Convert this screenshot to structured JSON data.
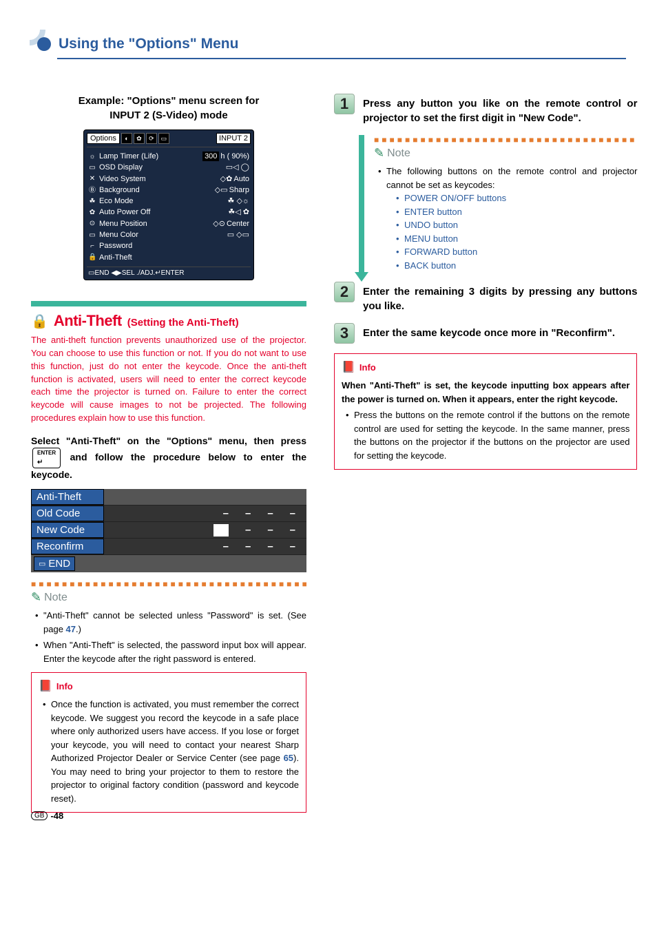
{
  "header": {
    "title": "Using the \"Options\" Menu"
  },
  "example": {
    "line1": "Example: \"Options\" menu screen for",
    "line2": "INPUT 2 (S-Video) mode"
  },
  "options_screen": {
    "active_tab": "Options",
    "input_label": "INPUT 2",
    "rows": {
      "lamp": {
        "label": "Lamp Timer (Life)",
        "value": "300",
        "unit": "h (   90%)"
      },
      "osd": {
        "label": "OSD Display"
      },
      "video": {
        "label": "Video System",
        "value": "Auto"
      },
      "bg": {
        "label": "Background",
        "value": "Sharp"
      },
      "eco": {
        "label": "Eco Mode"
      },
      "autopower": {
        "label": "Auto Power Off"
      },
      "menupos": {
        "label": "Menu Position",
        "value": "Center"
      },
      "menucolor": {
        "label": "Menu Color"
      },
      "password": {
        "label": "Password"
      },
      "antitheft": {
        "label": "Anti-Theft"
      }
    },
    "footer": "END ◀▶SEL ./ADJ.↵ENTER"
  },
  "anti_theft": {
    "title": "Anti-Theft",
    "subtitle": "(Setting the Anti-Theft)",
    "intro": "The anti-theft function prevents unauthorized use of the projector. You can choose to use this function or not. If you do not want to use this function, just do not enter the keycode. Once the anti-theft function is activated, users will need to enter the correct keycode each time the projector is turned on. Failure to enter the correct keycode will cause images to not be projected. The following procedures explain how to use this function.",
    "select_inst_before": "Select \"Anti-Theft\" on the \"Options\" menu, then press ",
    "enter_label": "ENTER",
    "enter_symbol": "↵",
    "select_inst_after": " and follow the procedure below to enter the keycode."
  },
  "at_table": {
    "header": "Anti-Theft",
    "old": "Old Code",
    "new": "New Code",
    "reconfirm": "Reconfirm",
    "end": "END"
  },
  "note1": {
    "label": "Note",
    "item1_a": "\"Anti-Theft\" cannot be selected unless \"Password\" is set. (See page ",
    "item1_page": "47",
    "item1_b": ".)",
    "item2": "When \"Anti-Theft\" is selected, the password input box will appear. Enter the keycode after the right password is entered."
  },
  "info1": {
    "label": "Info",
    "item_a": "Once the function is activated, you must remember the correct keycode. We suggest you record the keycode in a safe place where only authorized users have access. If you lose or forget your keycode, you will need to contact your nearest Sharp Authorized Projector Dealer or Service Center (see page ",
    "item_page": "65",
    "item_b": ").  You may need to bring your projector to them to restore the projector to original factory condition (password and keycode reset)."
  },
  "steps": {
    "s1": {
      "num": "1",
      "text": "Press any button you like on the remote control or projector to set the first digit in \"New Code\"."
    },
    "s2": {
      "num": "2",
      "text": "Enter the remaining 3 digits by pressing any buttons you like."
    },
    "s3": {
      "num": "3",
      "text": "Enter the same keycode once more in \"Reconfirm\"."
    }
  },
  "note2": {
    "label": "Note",
    "intro": "The following buttons on the remote control and projector cannot be set as keycodes:",
    "items": [
      "POWER ON/OFF buttons",
      "ENTER button",
      "UNDO button",
      "MENU button",
      "FORWARD button",
      "BACK button"
    ]
  },
  "info2": {
    "label": "Info",
    "bold": "When \"Anti-Theft\" is set, the keycode inputting box appears after the power is turned on. When it appears, enter the right keycode.",
    "bullet": "Press the buttons on the remote control if the buttons on the remote control are used for setting the keycode. In the same manner, press the buttons on the projector if the buttons on the projector are used for setting the keycode."
  },
  "pagenum": {
    "region": "GB",
    "num": "-48"
  }
}
